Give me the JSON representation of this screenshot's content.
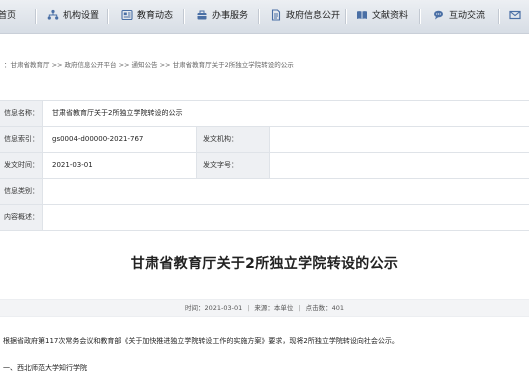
{
  "nav": {
    "items": [
      {
        "label": "首页",
        "icon": "home-icon"
      },
      {
        "label": "机构设置",
        "icon": "organization-icon"
      },
      {
        "label": "教育动态",
        "icon": "news-icon"
      },
      {
        "label": "办事服务",
        "icon": "service-icon"
      },
      {
        "label": "政府信息公开",
        "icon": "document-icon"
      },
      {
        "label": "文献资料",
        "icon": "book-icon"
      },
      {
        "label": "互动交流",
        "icon": "chat-icon"
      }
    ]
  },
  "breadcrumb": "：甘肃省教育厅 >> 政府信息公开平台 >> 通知公告 >> 甘肃省教育厅关于2所独立学院转设的公示",
  "info": {
    "name_label": "信息名称：",
    "name_value": "甘肃省教育厅关于2所独立学院转设的公示",
    "index_label": "信息索引：",
    "index_value": "gs0004-d00000-2021-767",
    "org_label": "发文机构：",
    "org_value": "",
    "date_label": "发文时间：",
    "date_value": "2021-03-01",
    "docno_label": "发文字号：",
    "docno_value": "",
    "category_label": "信息类别：",
    "category_value": "",
    "summary_label": "内容概述：",
    "summary_value": ""
  },
  "article": {
    "title": "甘肃省教育厅关于2所独立学院转设的公示",
    "meta_time": "时间：2021-03-01",
    "meta_source": "来源：本单位",
    "meta_views": "点击数：401",
    "para1": "根据省政府第117次常务会议和教育部《关于加快推进独立学院转设工作的实施方案》要求，现将2所独立学院转设向社会公示。",
    "para2": "一、西北师范大学知行学院"
  }
}
